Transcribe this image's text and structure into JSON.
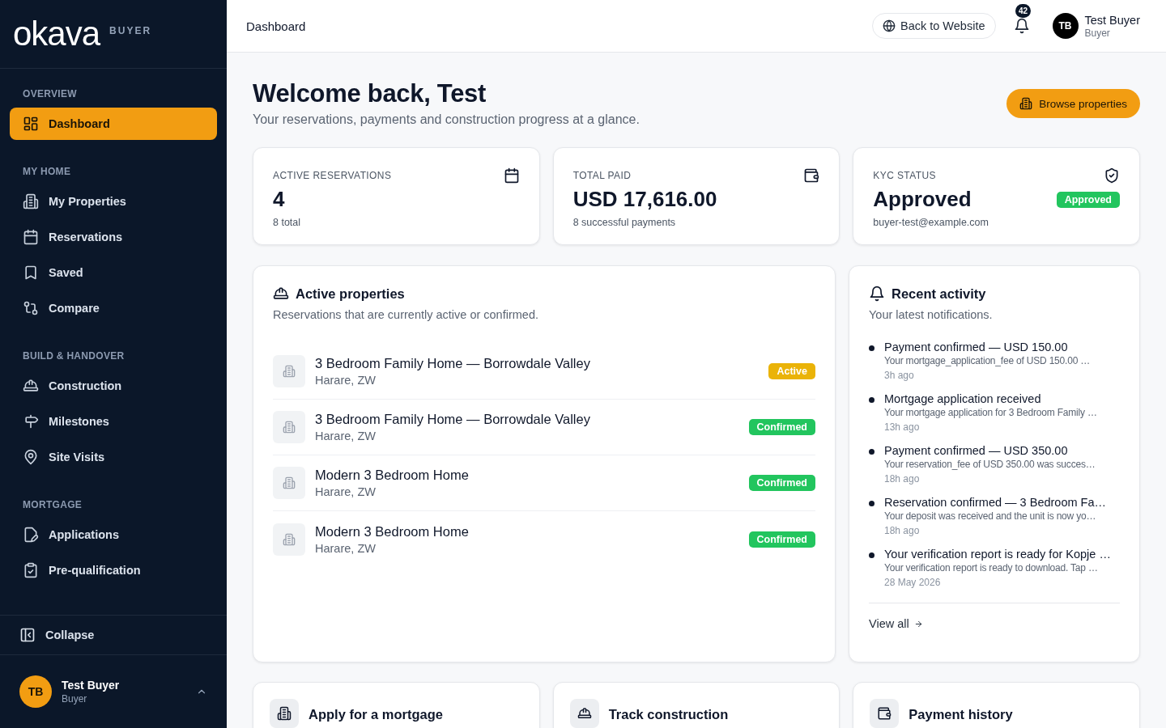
{
  "sidebar": {
    "logo": "okava",
    "role": "BUYER",
    "sections": [
      {
        "heading": "OVERVIEW",
        "items": [
          {
            "label": "Dashboard",
            "selected": true
          }
        ]
      },
      {
        "heading": "MY HOME",
        "items": [
          {
            "label": "My Properties",
            "selected": false
          },
          {
            "label": "Reservations",
            "selected": false
          },
          {
            "label": "Saved",
            "selected": false
          },
          {
            "label": "Compare",
            "selected": false
          }
        ]
      },
      {
        "heading": "BUILD & HANDOVER",
        "items": [
          {
            "label": "Construction",
            "selected": false
          },
          {
            "label": "Milestones",
            "selected": false
          },
          {
            "label": "Site Visits",
            "selected": false
          }
        ]
      },
      {
        "heading": "MORTGAGE",
        "items": [
          {
            "label": "Applications",
            "selected": false
          },
          {
            "label": "Pre-qualification",
            "selected": false
          }
        ]
      }
    ],
    "collapse": "Collapse",
    "user": {
      "initials": "TB",
      "name": "Test Buyer",
      "role": "Buyer"
    }
  },
  "header": {
    "title": "Dashboard",
    "back_link": "Back to Website",
    "notification_count": "42",
    "user": {
      "initials": "TB",
      "name": "Test Buyer",
      "role": "Buyer"
    }
  },
  "welcome": {
    "title": "Welcome back, Test",
    "subtitle": "Your reservations, payments and construction progress at a glance.",
    "action": "Browse properties"
  },
  "stats": [
    {
      "label": "ACTIVE RESERVATIONS",
      "value": "4",
      "detail": "8 total"
    },
    {
      "label": "TOTAL PAID",
      "value": "USD 17,616.00",
      "detail": "8 successful payments"
    },
    {
      "label": "KYC STATUS",
      "value": "Approved",
      "detail": "buyer-test@example.com",
      "badge": {
        "text": "Approved",
        "kind": "approved"
      }
    }
  ],
  "active_properties": {
    "title": "Active properties",
    "subtitle": "Reservations that are currently active or confirmed.",
    "items": [
      {
        "name": "3 Bedroom Family Home — Borrowdale Valley",
        "location": "Harare, ZW",
        "status": {
          "text": "Active",
          "kind": "active"
        }
      },
      {
        "name": "3 Bedroom Family Home — Borrowdale Valley",
        "location": "Harare, ZW",
        "status": {
          "text": "Confirmed",
          "kind": "confirmed"
        }
      },
      {
        "name": "Modern 3 Bedroom Home",
        "location": "Harare, ZW",
        "status": {
          "text": "Confirmed",
          "kind": "confirmed"
        }
      },
      {
        "name": "Modern 3 Bedroom Home",
        "location": "Harare, ZW",
        "status": {
          "text": "Confirmed",
          "kind": "confirmed"
        }
      }
    ]
  },
  "recent_activity": {
    "title": "Recent activity",
    "subtitle": "Your latest notifications.",
    "items": [
      {
        "title": "Payment confirmed — USD 150.00",
        "body": "Your mortgage_application_fee of USD 150.00 …",
        "time": "3h ago"
      },
      {
        "title": "Mortgage application received",
        "body": "Your mortgage application for 3 Bedroom Family …",
        "time": "13h ago"
      },
      {
        "title": "Payment confirmed — USD 350.00",
        "body": "Your reservation_fee of USD 350.00 was succes…",
        "time": "18h ago"
      },
      {
        "title": "Reservation confirmed — 3 Bedroom Fa…",
        "body": "Your deposit was received and the unit is now yo…",
        "time": "18h ago"
      },
      {
        "title": "Your verification report is ready for Kopje …",
        "body": "Your verification report is ready to download. Tap …",
        "time": "28 May 2026"
      }
    ],
    "view_all": "View all"
  },
  "quick_links": [
    {
      "label": "Apply for a mortgage"
    },
    {
      "label": "Track construction"
    },
    {
      "label": "Payment history"
    }
  ]
}
